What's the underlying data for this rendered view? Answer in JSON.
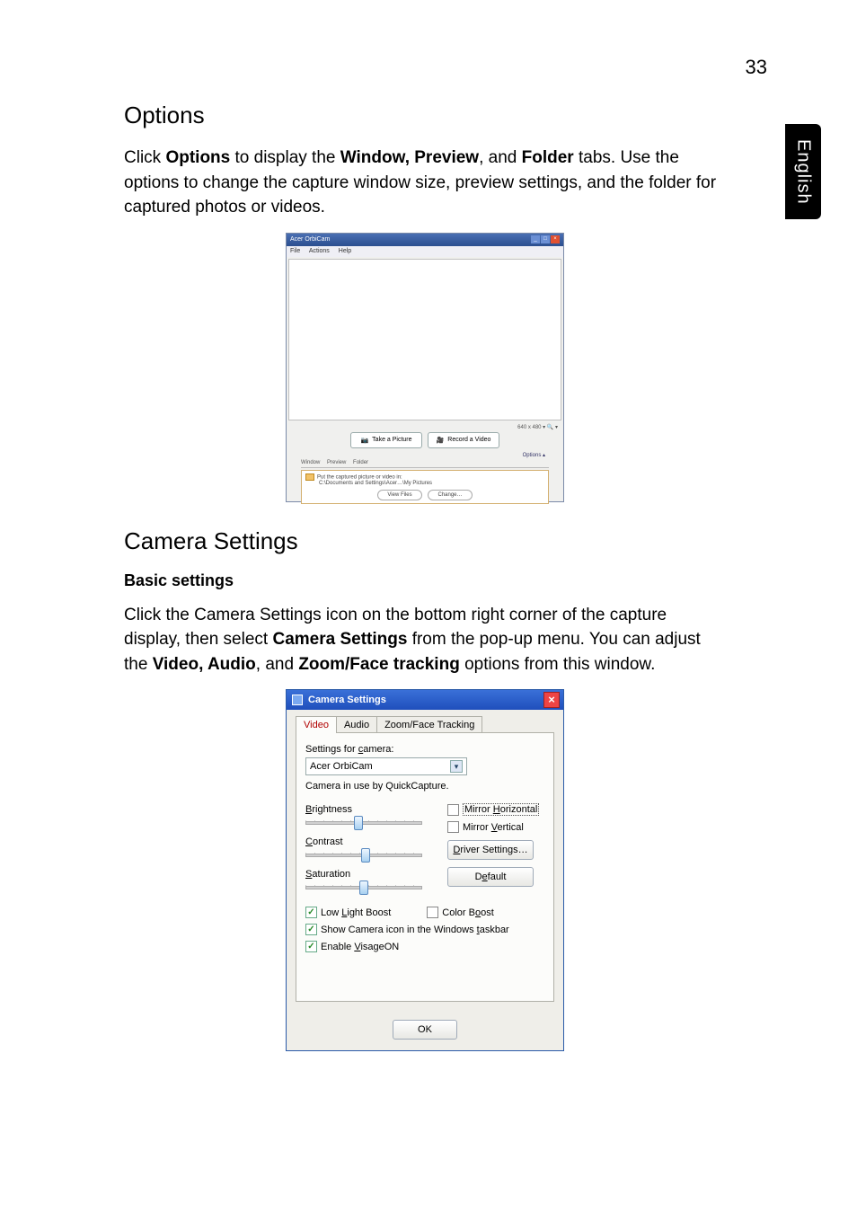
{
  "pageNumber": "33",
  "sideTab": "English",
  "section1": {
    "heading": "Options",
    "para_pre": "Click ",
    "para_b1": "Options",
    "para_mid1": " to display the ",
    "para_b2": "Window, Preview",
    "para_mid2": ", and ",
    "para_b3": "Folder",
    "para_post": " tabs. Use the options to change the capture window size, preview settings, and the folder for captured photos or videos."
  },
  "shot1": {
    "title": "Acer OrbiCam",
    "menuFile": "File",
    "menuActions": "Actions",
    "menuHelp": "Help",
    "status": "640 x 480 ▾   🔍 ▾",
    "btnPic": "Take a Picture",
    "btnVid": "Record a Video",
    "optionsLink": "Options  ▴",
    "tabWindow": "Window",
    "tabPreview": "Preview",
    "tabFolder": "Folder",
    "folderLine1": "Put the captured picture or video in:",
    "folderLine2": "C:\\Documents and Settings\\Acer…\\My Pictures",
    "btnView": "View Files",
    "btnChange": "Change…"
  },
  "section2": {
    "heading": "Camera Settings",
    "sub": "Basic settings",
    "para_pre": "Click the Camera Settings icon on the bottom right corner of the capture display, then select ",
    "para_b1": "Camera Settings",
    "para_mid1": " from the pop-up menu. You can adjust the ",
    "para_b2": "Video, Audio",
    "para_mid2": ", and ",
    "para_b3": "Zoom/Face tracking",
    "para_post": " options from this window."
  },
  "shot2": {
    "title": "Camera Settings",
    "tabVideo": "Video",
    "tabAudio": "Audio",
    "tabZoom": "Zoom/Face Tracking",
    "settingsFor": "Settings for camera:",
    "cameraName": "Acer OrbiCam",
    "inUse": "Camera in use by QuickCapture.",
    "brightness": "Brightness",
    "contrast": "Contrast",
    "saturation": "Saturation",
    "mirrorH": "Mirror Horizontal",
    "mirrorV": "Mirror Vertical",
    "driver": "Driver Settings…",
    "default": "Default",
    "lowLight": "Low Light Boost",
    "colorBoost": "Color Boost",
    "showIcon": "Show Camera icon in the Windows taskbar",
    "enableVisage": "Enable VisageON",
    "ok": "OK"
  }
}
